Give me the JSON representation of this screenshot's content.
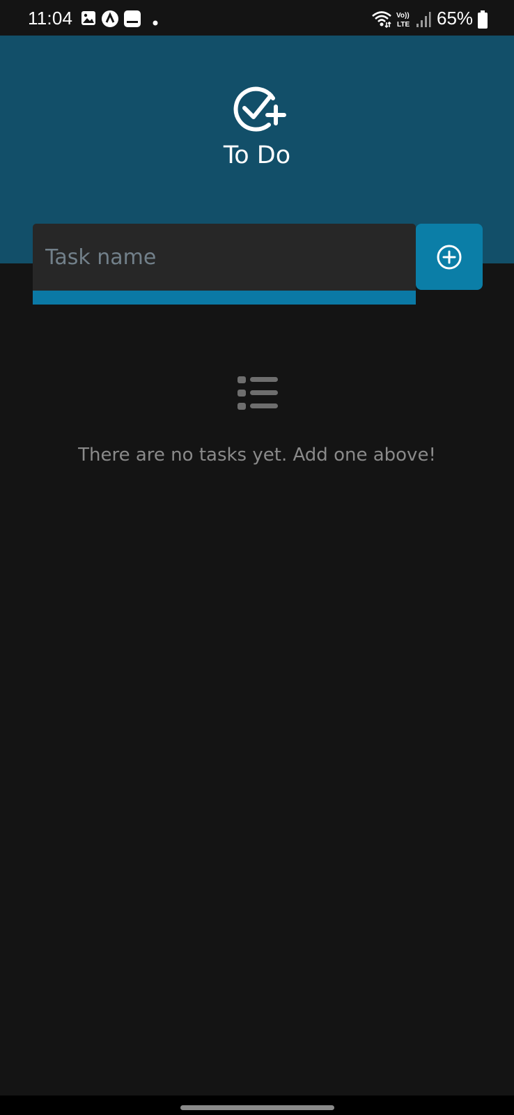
{
  "status_bar": {
    "time": "11:04",
    "battery_percent": "65%",
    "network": "Vo)) LTE",
    "icons": [
      "image-icon",
      "app-a-icon",
      "app-window-icon",
      "dot-icon",
      "wifi-icon",
      "volte-icon",
      "signal-icon",
      "battery-icon"
    ]
  },
  "header": {
    "title": "To Do",
    "logo_icon": "check-circle-plus-icon",
    "background": "#124f69"
  },
  "task_input": {
    "value": "",
    "placeholder": "Task name",
    "accent": "#0b79a5"
  },
  "add_button": {
    "icon": "plus-circle-icon",
    "color": "#0b7ea7"
  },
  "empty_state": {
    "icon": "list-icon",
    "message": "There are no tasks yet. Add one above!"
  },
  "colors": {
    "background": "#141414",
    "input_background": "#272727",
    "muted_text": "#8a8a8a"
  }
}
